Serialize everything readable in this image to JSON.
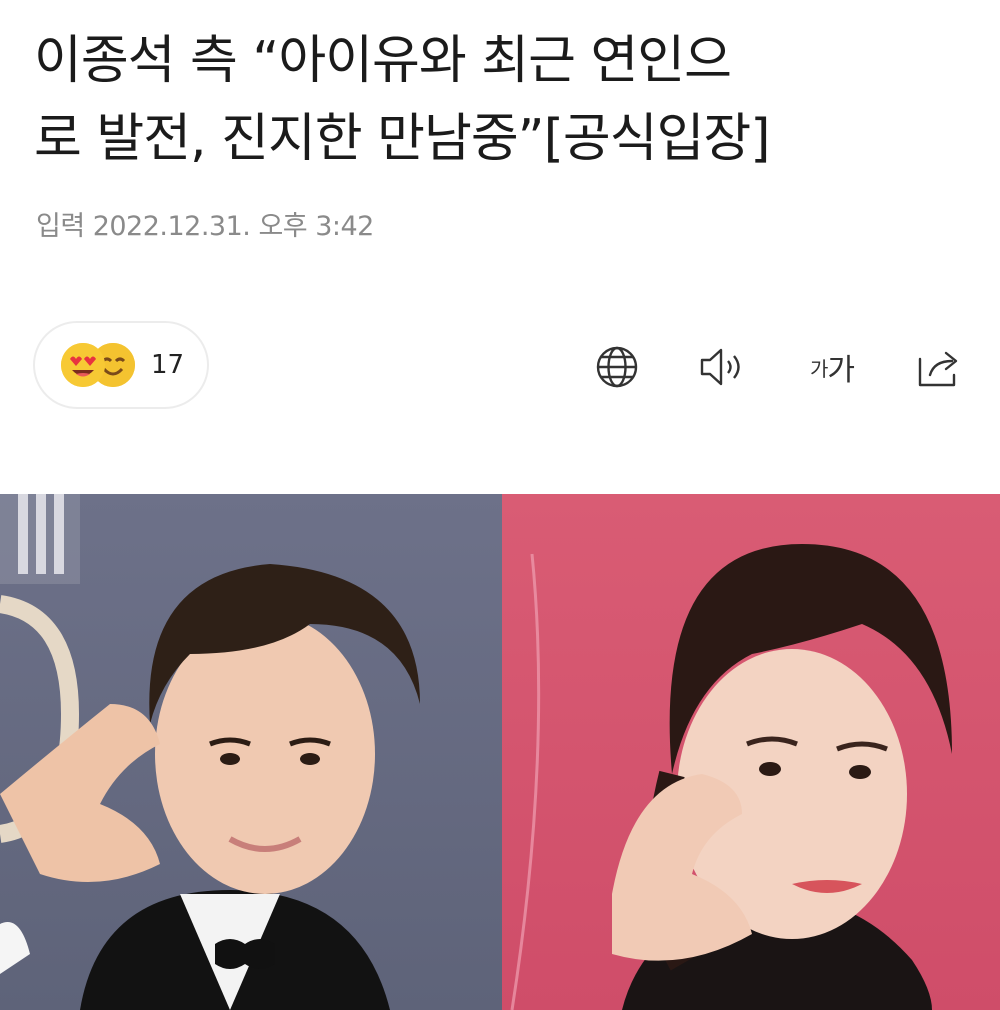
{
  "article": {
    "title_line1": "이종석 측 “아이유와 최근 연인으",
    "title_line2": "로 발전, 진지한 만남중”[공식입장]",
    "date_label": "입력",
    "date_value": "2022.12.31. 오후 3:42"
  },
  "reactions": {
    "count": "17",
    "emoji_icons": [
      "heart-eyes-emoji-icon",
      "smiling-emoji-icon"
    ]
  },
  "toolbar": {
    "translate_icon": "globe-icon",
    "tts_icon": "speaker-icon",
    "font_size_small": "가",
    "font_size_large": "가",
    "share_icon": "share-icon"
  },
  "photos": {
    "left": "male-actor-heart-gesture-photo",
    "right": "female-singer-heart-gesture-photo"
  },
  "colors": {
    "text": "#1b1b1b",
    "meta": "#8a8a8a",
    "pill_border": "#ececec",
    "emoji_yellow": "#f7c934"
  }
}
